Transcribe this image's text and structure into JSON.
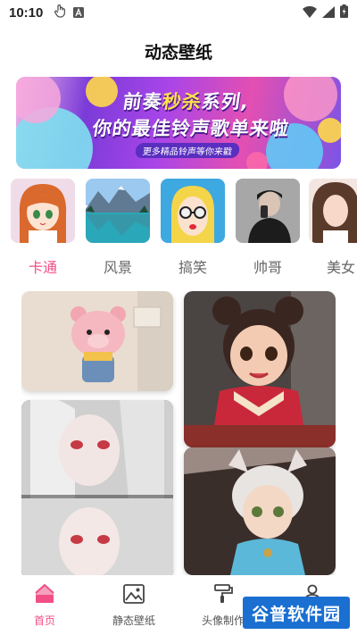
{
  "status_bar": {
    "time": "10:10",
    "icons": [
      "gesture-icon",
      "notification-a-icon",
      "wifi-icon",
      "signal-icon",
      "battery-charging-icon"
    ]
  },
  "page": {
    "title": "动态壁纸"
  },
  "banner": {
    "line1_prefix": "前奏",
    "line1_highlight": "秒杀",
    "line1_suffix": "系列,",
    "line2": "你的最佳铃声歌单来啦",
    "subtitle": "更多精品铃声等你来戳"
  },
  "categories": {
    "active_index": 0,
    "items": [
      {
        "label": "卡通",
        "thumb": "cartoon-girl-thumbnail"
      },
      {
        "label": "风景",
        "thumb": "mountain-lake-thumbnail"
      },
      {
        "label": "搞笑",
        "thumb": "sunglasses-girl-thumbnail"
      },
      {
        "label": "帅哥",
        "thumb": "man-portrait-thumbnail"
      },
      {
        "label": "美女",
        "thumb": "woman-portrait-thumbnail"
      }
    ]
  },
  "wallpapers": [
    {
      "name": "pink-bear-wallpaper"
    },
    {
      "name": "white-hair-girl-wallpaper"
    },
    {
      "name": "chinese-girl-wallpaper"
    },
    {
      "name": "cat-ear-boy-wallpaper"
    }
  ],
  "bottom_nav": {
    "active_index": 0,
    "items": [
      {
        "label": "首页",
        "icon": "home-icon"
      },
      {
        "label": "静态壁纸",
        "icon": "image-icon"
      },
      {
        "label": "头像制作",
        "icon": "paint-roller-icon"
      },
      {
        "label": "",
        "icon": "profile-icon"
      }
    ]
  },
  "watermark": {
    "text": "谷普软件园"
  },
  "colors": {
    "accent": "#f24f86",
    "text_inactive": "#666666"
  }
}
